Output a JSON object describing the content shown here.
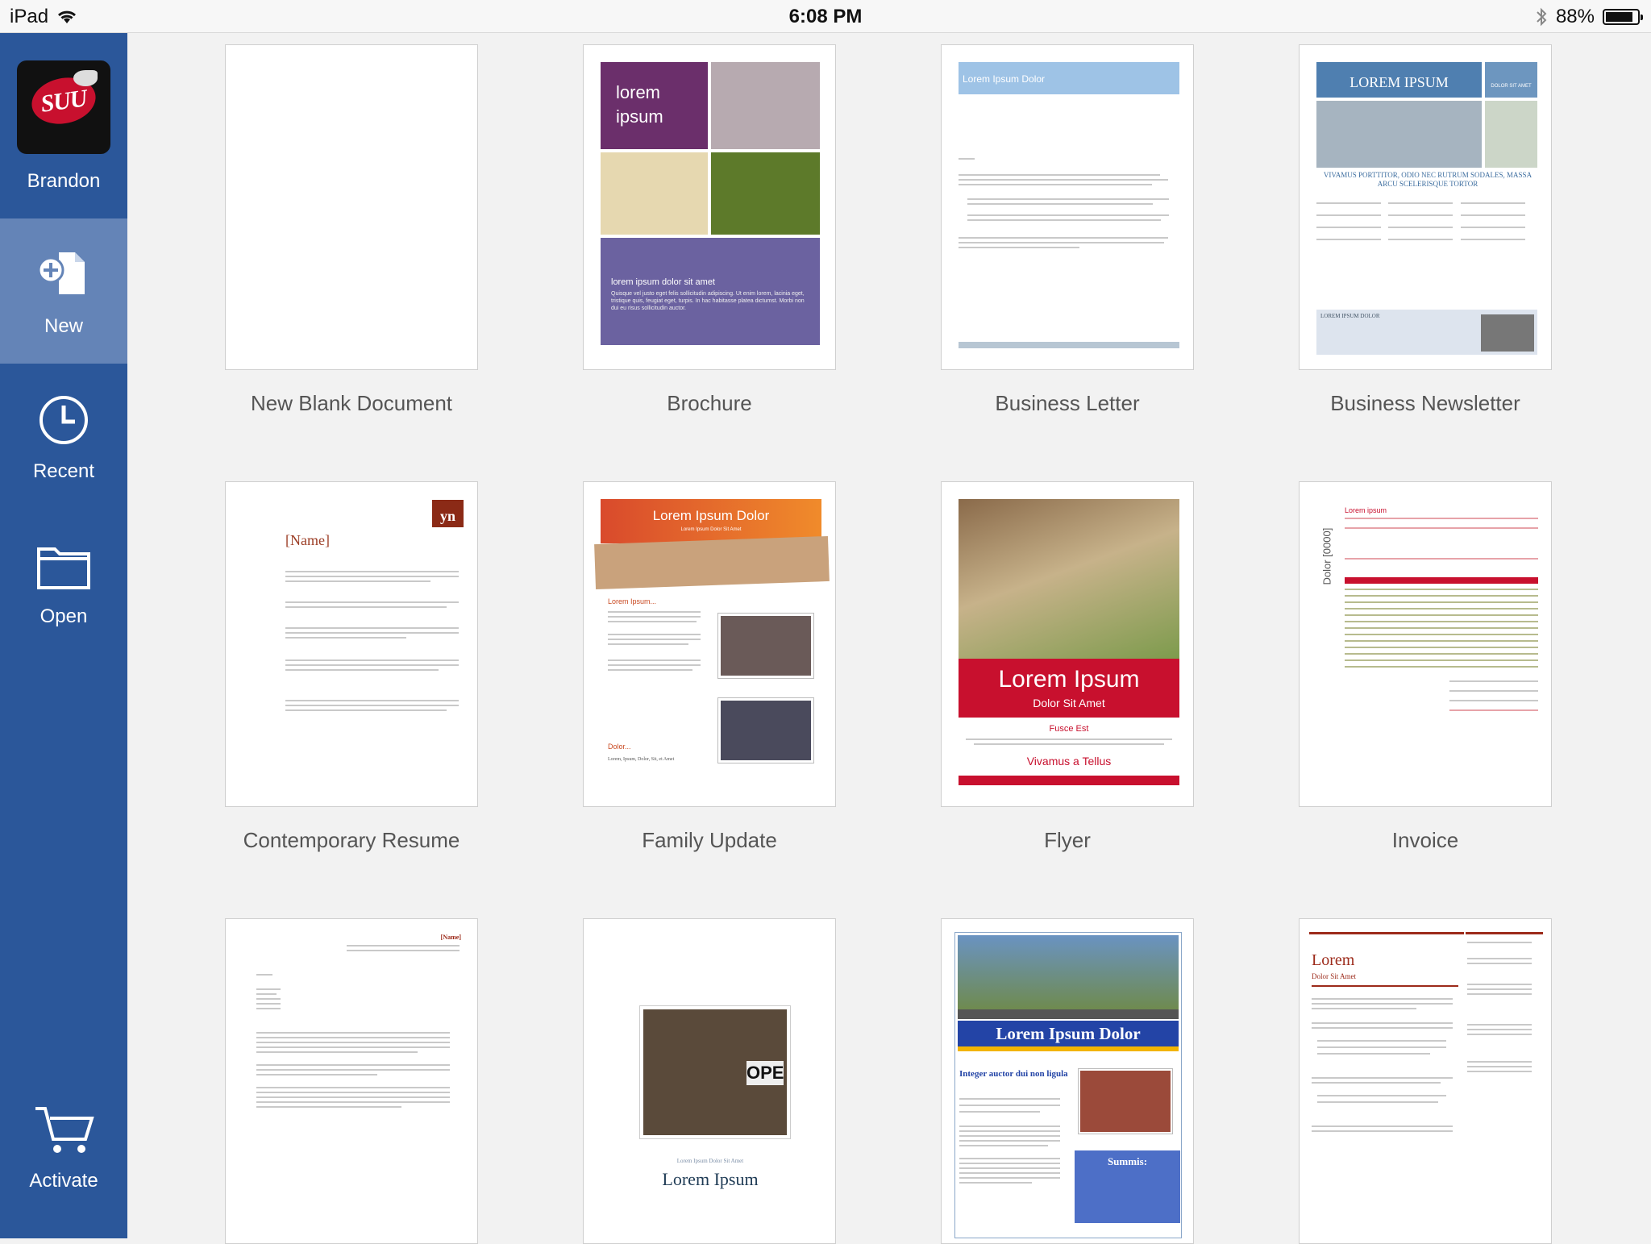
{
  "status_bar": {
    "device": "iPad",
    "time": "6:08 PM",
    "battery": "88%",
    "battery_level": 0.88
  },
  "sidebar": {
    "user": {
      "name": "Brandon",
      "logo_text": "SUU"
    },
    "items": [
      {
        "label": "New",
        "icon": "new-document-icon",
        "active": true
      },
      {
        "label": "Recent",
        "icon": "clock-icon",
        "active": false
      },
      {
        "label": "Open",
        "icon": "folder-icon",
        "active": false
      }
    ],
    "activate": {
      "label": "Activate",
      "icon": "cart-icon"
    }
  },
  "templates": [
    {
      "name": "New Blank Document"
    },
    {
      "name": "Brochure",
      "text": {
        "title": "lorem ipsum",
        "subtitle": "lorem ipsum dolor sit amet",
        "body": "Quisque vel justo eget felis sollicitudin adipiscing. Ut enim lorem, lacinia eget, tristique quis, feugiat eget, turpis. In hac habitasse platea dictumst. Morbi non dui eu risus sollicitudin auctor."
      }
    },
    {
      "name": "Business Letter",
      "text": {
        "header": "Lorem Ipsum Dolor"
      }
    },
    {
      "name": "Business Newsletter",
      "text": {
        "masthead": "LOREM IPSUM",
        "side": "DOLOR SIT AMET",
        "headline": "VIVAMUS PORTTITOR, ODIO NEC RUTRUM SODALES, MASSA ARCU SCELERISQUE TORTOR",
        "box": "LOREM IPSUM DOLOR"
      }
    },
    {
      "name": "Contemporary Resume",
      "text": {
        "name": "[Name]",
        "initials": "yn"
      }
    },
    {
      "name": "Family Update",
      "text": {
        "title": "Lorem Ipsum Dolor",
        "subtitle": "Lorem Ipsum Dolor Sit Amet",
        "heading": "Lorem Ipsum...",
        "heading2": "Dolor...",
        "footer": "Lorem, Ipsum, Dolor, Sit, et Amet"
      }
    },
    {
      "name": "Flyer",
      "text": {
        "title": "Lorem Ipsum",
        "subtitle": "Dolor Sit Amet",
        "line1": "Fusce Est",
        "line2": "Vivamus a Tellus"
      }
    },
    {
      "name": "Invoice",
      "text": {
        "vertical": "Dolor [0000]",
        "title": "Lorem ipsum"
      }
    },
    {
      "name": "",
      "text": {
        "name": "[Name]"
      }
    },
    {
      "name": "",
      "text": {
        "small": "Lorem Ipsum Dolor Sit Amet",
        "title": "Lorem Ipsum",
        "sign": "OPE"
      }
    },
    {
      "name": "",
      "text": {
        "banner": "Lorem Ipsum Dolor",
        "heading": "Integer auctor dui non ligula",
        "box": "Summis:"
      }
    },
    {
      "name": "",
      "text": {
        "title": "Lorem",
        "subtitle": "Dolor Sit Amet"
      }
    }
  ]
}
